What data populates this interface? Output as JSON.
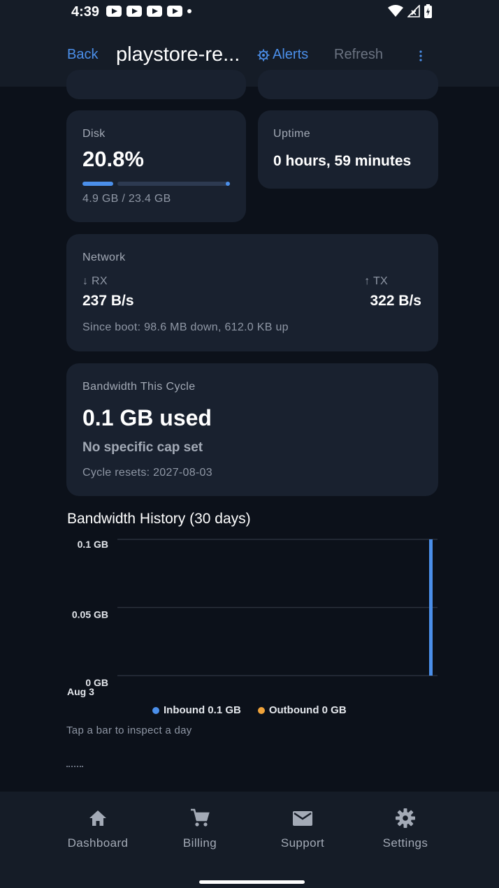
{
  "statusbar": {
    "time": "4:39"
  },
  "appbar": {
    "back": "Back",
    "title": "playstore-re...",
    "alerts": "Alerts",
    "refresh": "Refresh"
  },
  "disk": {
    "label": "Disk",
    "percent": "20.8%",
    "fraction": 0.208,
    "usage": "4.9 GB / 23.4 GB"
  },
  "uptime": {
    "label": "Uptime",
    "value": "0 hours, 59 minutes"
  },
  "network": {
    "label": "Network",
    "rx_label": "↓ RX",
    "rx_value": "237 B/s",
    "tx_label": "↑ TX",
    "tx_value": "322 B/s",
    "since_boot": "Since boot: 98.6 MB down, 612.0 KB up"
  },
  "bandwidth": {
    "label": "Bandwidth This Cycle",
    "used": "0.1 GB used",
    "cap": "No specific cap set",
    "resets": "Cycle resets: 2027-08-03"
  },
  "history": {
    "title": "Bandwidth History (30 days)",
    "hint": "Tap a bar to inspect a day"
  },
  "colors": {
    "accent": "#4b8fea",
    "inbound": "#4b8fea",
    "outbound": "#f0a33a"
  },
  "chart_data": {
    "type": "bar",
    "y_ticks": [
      "0.1 GB",
      "0.05 GB",
      "0 GB"
    ],
    "ylim": [
      0,
      0.1
    ],
    "x_tick": "Aug 3",
    "num_days": 30,
    "series": [
      {
        "name": "Inbound 0.1 GB",
        "color": "#4b8fea",
        "values": [
          0,
          0,
          0,
          0,
          0,
          0,
          0,
          0,
          0,
          0,
          0,
          0,
          0,
          0,
          0,
          0,
          0,
          0,
          0,
          0,
          0,
          0,
          0,
          0,
          0,
          0,
          0,
          0,
          0,
          0.1
        ]
      },
      {
        "name": "Outbound 0 GB",
        "color": "#f0a33a",
        "values": [
          0,
          0,
          0,
          0,
          0,
          0,
          0,
          0,
          0,
          0,
          0,
          0,
          0,
          0,
          0,
          0,
          0,
          0,
          0,
          0,
          0,
          0,
          0,
          0,
          0,
          0,
          0,
          0,
          0,
          0
        ]
      }
    ]
  },
  "nav": {
    "items": [
      {
        "label": "Dashboard",
        "icon": "home-icon"
      },
      {
        "label": "Billing",
        "icon": "cart-icon"
      },
      {
        "label": "Support",
        "icon": "mail-icon"
      },
      {
        "label": "Settings",
        "icon": "gear-icon"
      }
    ]
  }
}
